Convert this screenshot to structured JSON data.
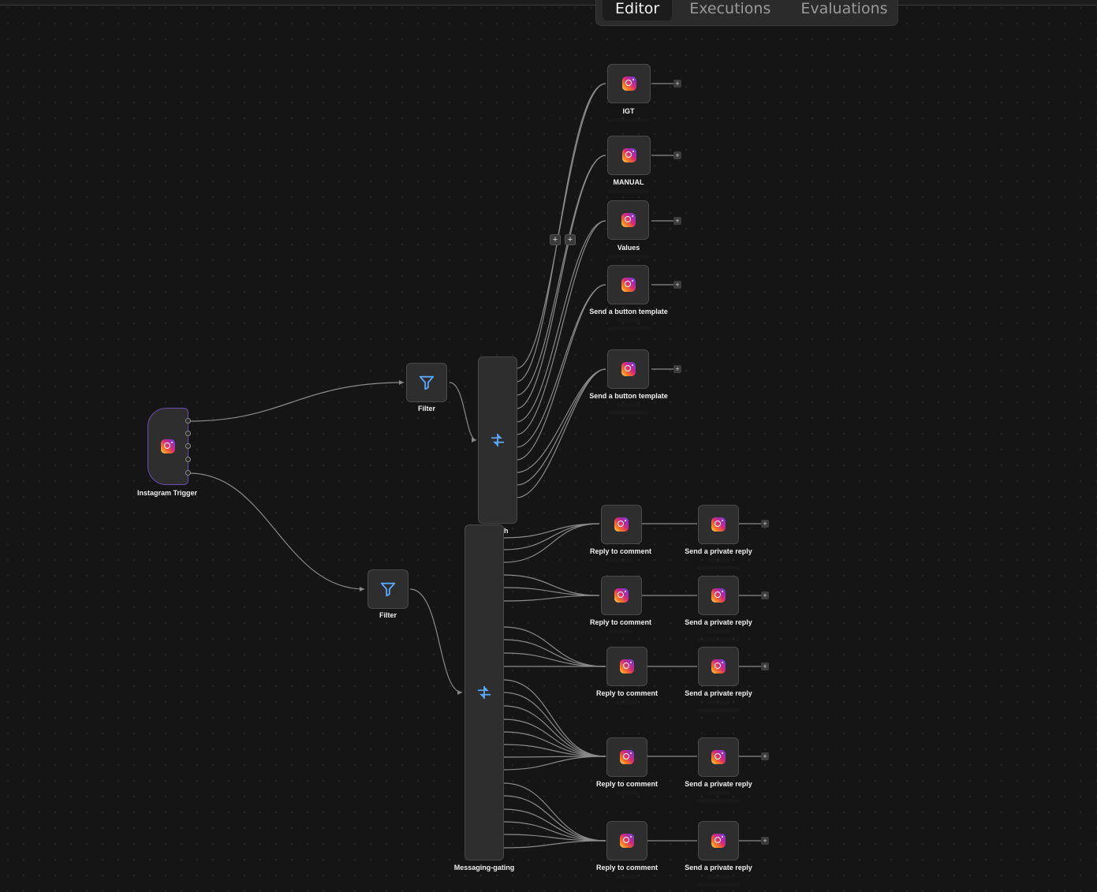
{
  "tabs": [
    {
      "label": "Editor",
      "active": true
    },
    {
      "label": "Executions",
      "active": false
    },
    {
      "label": "Evaluations",
      "active": false
    }
  ],
  "nodes": {
    "trigger": {
      "label": "Instagram Trigger",
      "icon": "instagram-icon"
    },
    "filter_top": {
      "label": "Filter",
      "icon": "filter-icon"
    },
    "filter_bottom": {
      "label": "Filter",
      "icon": "filter-icon"
    },
    "switch": {
      "label": "Switch",
      "icon": "switch-icon"
    },
    "messaging_gating": {
      "label": "Messaging-gating",
      "icon": "switch-icon"
    },
    "igt": {
      "label": "IGT"
    },
    "manual": {
      "label": "MANUAL"
    },
    "values": {
      "label": "Values"
    },
    "button_template_1": {
      "label": "Send a button template"
    },
    "button_template_2": {
      "label": "Send a button template"
    },
    "reply_1": {
      "label": "Reply to comment"
    },
    "reply_2": {
      "label": "Reply to comment"
    },
    "reply_3": {
      "label": "Reply to comment"
    },
    "reply_4": {
      "label": "Reply to comment"
    },
    "reply_5": {
      "label": "Reply to comment"
    },
    "private_1": {
      "label": "Send a private reply"
    },
    "private_2": {
      "label": "Send a private reply"
    },
    "private_3": {
      "label": "Send a private reply"
    },
    "private_4": {
      "label": "Send a private reply"
    },
    "private_5": {
      "label": "Send a private reply"
    }
  },
  "colors": {
    "canvas": "#151515",
    "node_fill": "#2e2e2e",
    "wire": "#8a8a8a",
    "accent_blue": "#5aa9ff",
    "trigger_border": "#6a4fb0"
  }
}
